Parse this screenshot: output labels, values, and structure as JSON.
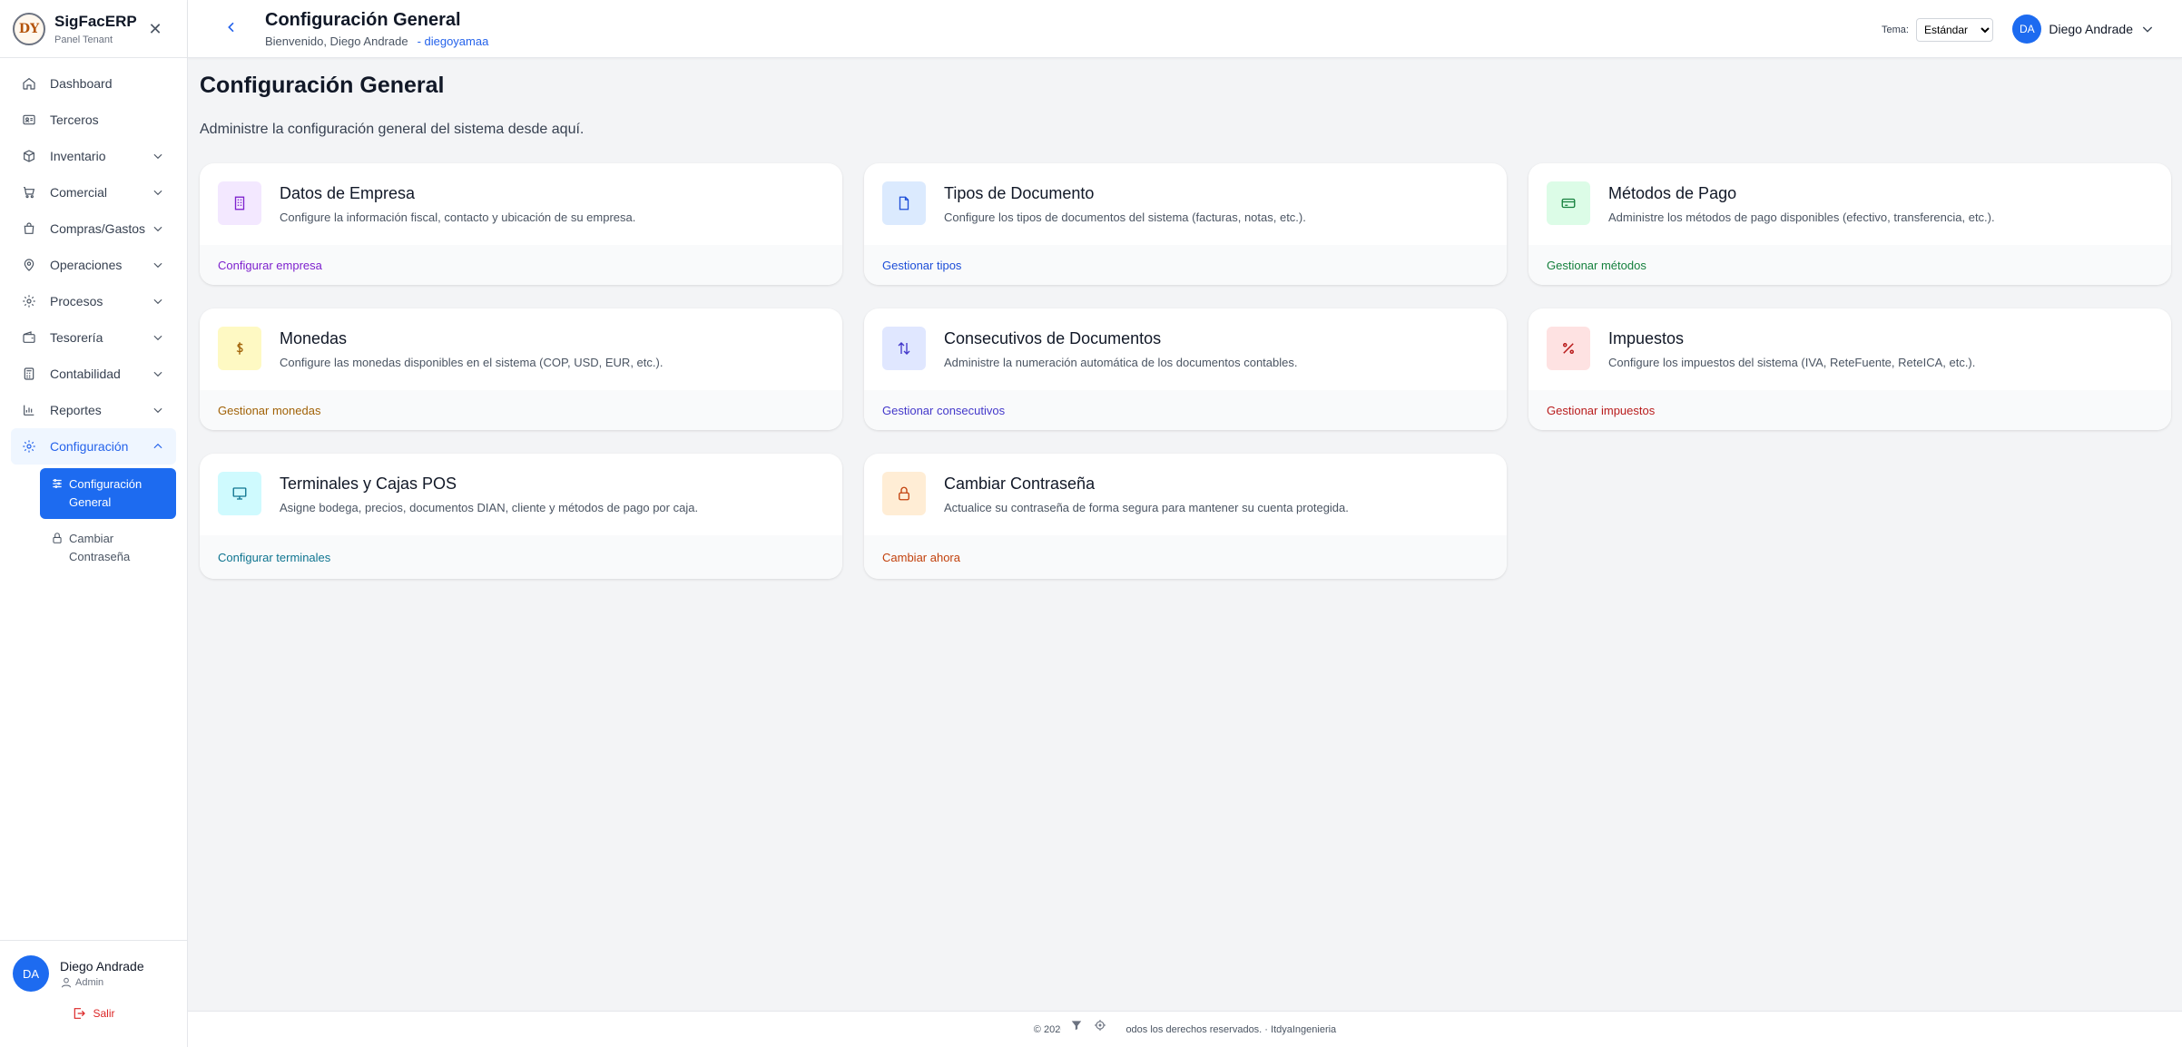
{
  "sidebar": {
    "brand": {
      "logo_text": "DY",
      "name": "SigFacERP",
      "sub": "Panel Tenant"
    },
    "items": [
      {
        "label": "Dashboard",
        "icon": "home-icon"
      },
      {
        "label": "Terceros",
        "icon": "id-card-icon"
      },
      {
        "label": "Inventario",
        "icon": "box-icon"
      },
      {
        "label": "Comercial",
        "icon": "cart-icon"
      },
      {
        "label": "Compras/Gastos",
        "icon": "bag-icon"
      },
      {
        "label": "Operaciones",
        "icon": "map-pin-icon"
      },
      {
        "label": "Procesos",
        "icon": "gear-icon"
      },
      {
        "label": "Tesorería",
        "icon": "wallet-icon"
      },
      {
        "label": "Contabilidad",
        "icon": "calculator-icon"
      },
      {
        "label": "Reportes",
        "icon": "bar-chart-icon"
      },
      {
        "label": "Configuración",
        "icon": "gear-icon"
      }
    ],
    "sub_items": [
      {
        "label": "Configuración General",
        "icon": "sliders-icon"
      },
      {
        "label": "Cambiar Contraseña",
        "icon": "lock-icon"
      }
    ],
    "footer": {
      "avatar": "DA",
      "user_name": "Diego Andrade",
      "role": "Admin",
      "logout": "Salir"
    }
  },
  "header": {
    "title": "Configuración General",
    "welcome": "Bienvenido, Diego Andrade",
    "handle": "- diegoyamaa",
    "theme_label": "Tema:",
    "theme_value": "Estándar",
    "avatar": "DA",
    "user_name": "Diego Andrade"
  },
  "main": {
    "title": "Configuración General",
    "description": "Administre la configuración general del sistema desde aquí.",
    "cards": [
      {
        "title": "Datos de Empresa",
        "desc": "Configure la información fiscal, contacto y ubicación de su empresa.",
        "link": "Configurar empresa",
        "icon": "building-icon",
        "color": "#7e22ce",
        "bg": "#f3e8ff"
      },
      {
        "title": "Tipos de Documento",
        "desc": "Configure los tipos de documentos del sistema (facturas, notas, etc.).",
        "link": "Gestionar tipos",
        "icon": "file-icon",
        "color": "#1d4ed8",
        "bg": "#dbeafe"
      },
      {
        "title": "Métodos de Pago",
        "desc": "Administre los métodos de pago disponibles (efectivo, transferencia, etc.).",
        "link": "Gestionar métodos",
        "icon": "credit-card-icon",
        "color": "#15803d",
        "bg": "#dcfce7"
      },
      {
        "title": "Monedas",
        "desc": "Configure las monedas disponibles en el sistema (COP, USD, EUR, etc.).",
        "link": "Gestionar monedas",
        "icon": "dollar-icon",
        "color": "#a16207",
        "bg": "#fef9c3"
      },
      {
        "title": "Consecutivos de Documentos",
        "desc": "Administre la numeración automática de los documentos contables.",
        "link": "Gestionar consecutivos",
        "icon": "sort-arrows-icon",
        "color": "#4338ca",
        "bg": "#e0e7ff"
      },
      {
        "title": "Impuestos",
        "desc": "Configure los impuestos del sistema (IVA, ReteFuente, ReteICA, etc.).",
        "link": "Gestionar impuestos",
        "icon": "percent-icon",
        "color": "#b91c1c",
        "bg": "#fee2e2"
      },
      {
        "title": "Terminales y Cajas POS",
        "desc": "Asigne bodega, precios, documentos DIAN, cliente y métodos de pago por caja.",
        "link": "Configurar terminales",
        "icon": "monitor-icon",
        "color": "#0e7490",
        "bg": "#cffafe"
      },
      {
        "title": "Cambiar Contraseña",
        "desc": "Actualice su contraseña de forma segura para mantener su cuenta protegida.",
        "link": "Cambiar ahora",
        "icon": "lock-icon",
        "color": "#c2410c",
        "bg": "#ffedd5"
      }
    ]
  },
  "footer": {
    "text_left": "© 2026",
    "text_right": "odos los derechos reservados. · ItdyaIngenieria"
  }
}
